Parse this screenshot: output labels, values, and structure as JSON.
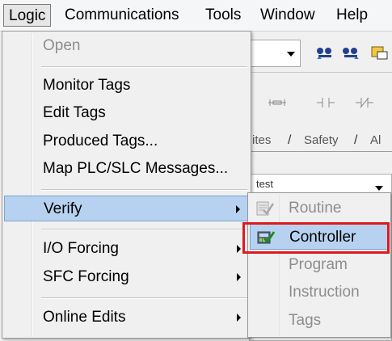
{
  "menubar": {
    "items": [
      {
        "label": "Logic"
      },
      {
        "label": "Communications"
      },
      {
        "label": "Tools"
      },
      {
        "label": "Window"
      },
      {
        "label": "Help"
      }
    ]
  },
  "background": {
    "tabs": [
      "ites",
      "Safety",
      "Al"
    ],
    "panel_text": "test"
  },
  "logic_menu": {
    "items": [
      {
        "label": "Open",
        "enabled": false
      },
      {
        "label": "Monitor Tags",
        "enabled": true
      },
      {
        "label": "Edit Tags",
        "enabled": true
      },
      {
        "label": "Produced Tags...",
        "enabled": true
      },
      {
        "label": "Map PLC/SLC Messages...",
        "enabled": true
      },
      {
        "label": "Verify",
        "enabled": true,
        "highlighted": true,
        "submenu": true
      },
      {
        "label": "I/O Forcing",
        "enabled": true,
        "submenu": true
      },
      {
        "label": "SFC Forcing",
        "enabled": true,
        "submenu": true
      },
      {
        "label": "Online Edits",
        "enabled": true,
        "submenu": true
      }
    ]
  },
  "verify_submenu": {
    "items": [
      {
        "label": "Routine",
        "enabled": false,
        "icon": "verify-routine-icon"
      },
      {
        "label": "Controller",
        "enabled": true,
        "highlighted": true,
        "icon": "verify-controller-icon"
      },
      {
        "label": "Program",
        "enabled": false
      },
      {
        "label": "Instruction",
        "enabled": false
      },
      {
        "label": "Tags",
        "enabled": false
      }
    ]
  },
  "colors": {
    "highlight": "#b7d2f0",
    "annotation": "#e0191f"
  }
}
